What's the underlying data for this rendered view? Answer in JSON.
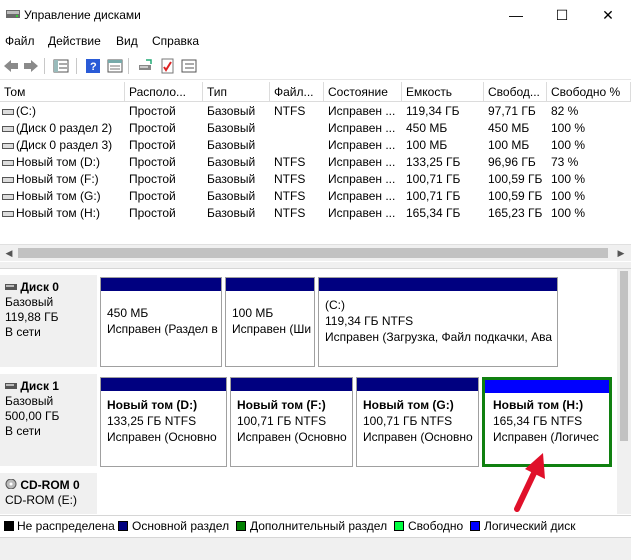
{
  "window": {
    "title": "Управление дисками",
    "minimize_glyph": "—",
    "maximize_glyph": "☐",
    "close_glyph": "✕"
  },
  "menu": [
    "Файл",
    "Действие",
    "Вид",
    "Справка"
  ],
  "toolbar": {
    "icons": [
      "back-arrow-icon",
      "forward-arrow-icon",
      "list-view-icon",
      "help-icon",
      "properties-icon",
      "connect-disk-icon",
      "checklist-icon",
      "settings-list-icon"
    ]
  },
  "table": {
    "columns": [
      "Том",
      "Располо...",
      "Тип",
      "Файл...",
      "Состояние",
      "Емкость",
      "Свобод...",
      "Свободно %"
    ],
    "rows": [
      [
        "(C:)",
        "Простой",
        "Базовый",
        "NTFS",
        "Исправен ...",
        "119,34 ГБ",
        "97,71 ГБ",
        "82 %"
      ],
      [
        "(Диск 0 раздел 2)",
        "Простой",
        "Базовый",
        "",
        "Исправен ...",
        "450 МБ",
        "450 МБ",
        "100 %"
      ],
      [
        "(Диск 0 раздел 3)",
        "Простой",
        "Базовый",
        "",
        "Исправен ...",
        "100 МБ",
        "100 МБ",
        "100 %"
      ],
      [
        "Новый том (D:)",
        "Простой",
        "Базовый",
        "NTFS",
        "Исправен ...",
        "133,25 ГБ",
        "96,96 ГБ",
        "73 %"
      ],
      [
        "Новый том (F:)",
        "Простой",
        "Базовый",
        "NTFS",
        "Исправен ...",
        "100,71 ГБ",
        "100,59 ГБ",
        "100 %"
      ],
      [
        "Новый том (G:)",
        "Простой",
        "Базовый",
        "NTFS",
        "Исправен ...",
        "100,71 ГБ",
        "100,59 ГБ",
        "100 %"
      ],
      [
        "Новый том (H:)",
        "Простой",
        "Базовый",
        "NTFS",
        "Исправен ...",
        "165,34 ГБ",
        "165,23 ГБ",
        "100 %"
      ]
    ]
  },
  "disks": [
    {
      "name": "Диск 0",
      "type": "Базовый",
      "size": "119,88 ГБ",
      "status": "В сети",
      "partitions": [
        {
          "title": "",
          "line1": "450 МБ",
          "line2": "Исправен (Раздел в",
          "kind": "primary"
        },
        {
          "title": "",
          "line1": "100 МБ",
          "line2": "Исправен (Ши",
          "kind": "primary"
        },
        {
          "title": "(C:)",
          "line1": "119,34 ГБ NTFS",
          "line2": "Исправен (Загрузка, Файл подкачки, Ава",
          "kind": "primary"
        }
      ]
    },
    {
      "name": "Диск 1",
      "type": "Базовый",
      "size": "500,00 ГБ",
      "status": "В сети",
      "partitions": [
        {
          "title": "Новый том  (D:)",
          "line1": "133,25 ГБ NTFS",
          "line2": "Исправен (Основно",
          "kind": "primary"
        },
        {
          "title": "Новый том  (F:)",
          "line1": "100,71 ГБ NTFS",
          "line2": "Исправен (Основно",
          "kind": "primary"
        },
        {
          "title": "Новый том  (G:)",
          "line1": "100,71 ГБ NTFS",
          "line2": "Исправен (Основно",
          "kind": "primary"
        },
        {
          "title": "Новый том  (H:)",
          "line1": "165,34 ГБ NTFS",
          "line2": "Исправен (Логичес",
          "kind": "logical"
        }
      ]
    },
    {
      "name": "CD-ROM 0",
      "line2": "CD-ROM (E:)"
    }
  ],
  "legend": [
    {
      "label": "Не распределена",
      "color": "#000000"
    },
    {
      "label": "Основной раздел",
      "color": "#000080"
    },
    {
      "label": "Дополнительный раздел",
      "color": "#008000"
    },
    {
      "label": "Свободно",
      "color": "#00ff40"
    },
    {
      "label": "Логический диск",
      "color": "#0000ff"
    }
  ],
  "colors": {
    "primary_bar": "#000080",
    "logical_bar": "#0000ff",
    "selected_border": "#108010",
    "arrow": "#e0102a"
  }
}
